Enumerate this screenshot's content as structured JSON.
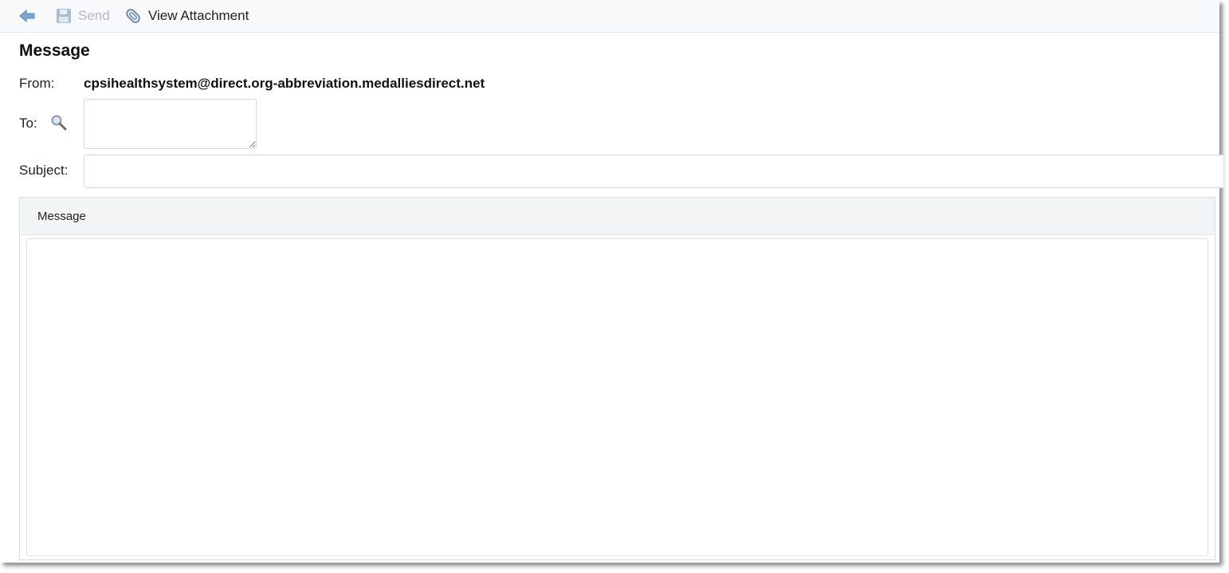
{
  "toolbar": {
    "back_icon": "back-arrow-icon",
    "send_label": "Send",
    "send_icon": "floppy-disk-icon",
    "attach_label": "View Attachment",
    "attach_icon": "paperclip-icon"
  },
  "form": {
    "title": "Message",
    "from_label": "From:",
    "from_value": "cpsihealthsystem@direct.org-abbreviation.medalliesdirect.net",
    "to_label": "To:",
    "to_search_icon": "magnifier-icon",
    "to_value": "",
    "subject_label": "Subject:",
    "subject_value": ""
  },
  "message_panel": {
    "header": "Message",
    "body": ""
  },
  "colors": {
    "toolbar_bg": "#f8f9fa",
    "disabled_text": "#b4b8bd",
    "icon_blue": "#6e9ac4",
    "panel_header_bg": "#f3f4f6"
  }
}
